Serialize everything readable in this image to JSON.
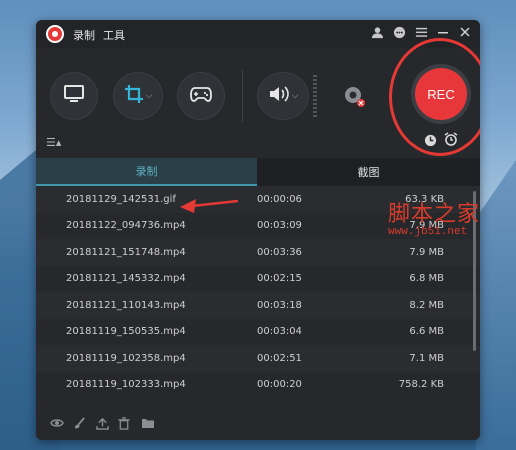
{
  "menu": {
    "record": "录制",
    "tools": "工具"
  },
  "titlebar_icons": [
    "user-icon",
    "chat-icon",
    "menu-icon",
    "minimize-icon",
    "close-icon"
  ],
  "toolbar": {
    "rec_label": "REC",
    "icons": [
      "monitor-icon",
      "crop-icon",
      "gamepad-icon",
      "speaker-icon",
      "webcam-icon"
    ]
  },
  "tabs": {
    "record": "录制",
    "screenshot": "截图"
  },
  "files": [
    {
      "name": "20181129_142531.gif",
      "duration": "00:00:06",
      "size": "63.3 KB"
    },
    {
      "name": "20181122_094736.mp4",
      "duration": "00:03:09",
      "size": "7.9 MB"
    },
    {
      "name": "20181121_151748.mp4",
      "duration": "00:03:36",
      "size": "7.9 MB"
    },
    {
      "name": "20181121_145332.mp4",
      "duration": "00:02:15",
      "size": "6.8 MB"
    },
    {
      "name": "20181121_110143.mp4",
      "duration": "00:03:18",
      "size": "8.2 MB"
    },
    {
      "name": "20181119_150535.mp4",
      "duration": "00:03:04",
      "size": "6.6 MB"
    },
    {
      "name": "20181119_102358.mp4",
      "duration": "00:02:51",
      "size": "7.1 MB"
    },
    {
      "name": "20181119_102333.mp4",
      "duration": "00:00:20",
      "size": "758.2 KB"
    }
  ],
  "bottom_icons": [
    "eye-icon",
    "brush-icon",
    "upload-icon",
    "trash-icon",
    "folder-icon"
  ],
  "watermark": {
    "title": "脚本之家",
    "url": "www.jb51.net"
  },
  "colors": {
    "accent": "#3f97ad",
    "rec": "#e8373b",
    "annotation": "#e53935"
  }
}
